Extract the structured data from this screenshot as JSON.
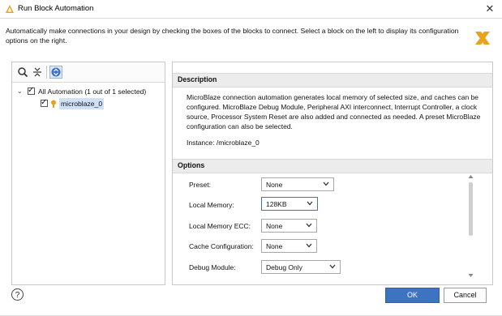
{
  "window": {
    "title": "Run Block Automation",
    "close_symbol": "✕"
  },
  "intro_text": "Automatically make connections in your design by checking the boxes of the blocks to connect. Select a block on the left to display its configuration options on the right.",
  "tree": {
    "root_label": "All Automation (1 out of 1 selected)",
    "child_label": "microblaze_0",
    "root_checked": true,
    "child_checked": true
  },
  "description": {
    "header": "Description",
    "text": "MicroBlaze connection automation generates local memory of selected size, and caches can be configured. MicroBlaze Debug Module, Peripheral AXI interconnect, Interrupt Controller, a clock source, Processor System Reset are also added and connected as needed. A preset MicroBlaze configuration can also be selected.",
    "instance": "Instance: /microblaze_0"
  },
  "options": {
    "header": "Options",
    "items": [
      {
        "label": "Preset:",
        "value": "None"
      },
      {
        "label": "Local Memory:",
        "value": "128KB"
      },
      {
        "label": "Local Memory ECC:",
        "value": "None"
      },
      {
        "label": "Cache Configuration:",
        "value": "None"
      },
      {
        "label": "Debug Module:",
        "value": "Debug Only"
      }
    ]
  },
  "buttons": {
    "help": "?",
    "ok": "OK",
    "cancel": "Cancel"
  },
  "colors": {
    "accent": "#3d74c2",
    "brand": "#e9a31a",
    "selection": "#cfe0f7"
  },
  "icons": [
    "run-automation-icon",
    "close-icon",
    "xilinx-logo",
    "search-icon",
    "collapse-all-icon",
    "expand-all-icon",
    "chevron-down-icon",
    "ip-block-icon",
    "scroll-up-icon",
    "scroll-down-icon",
    "help-icon"
  ]
}
